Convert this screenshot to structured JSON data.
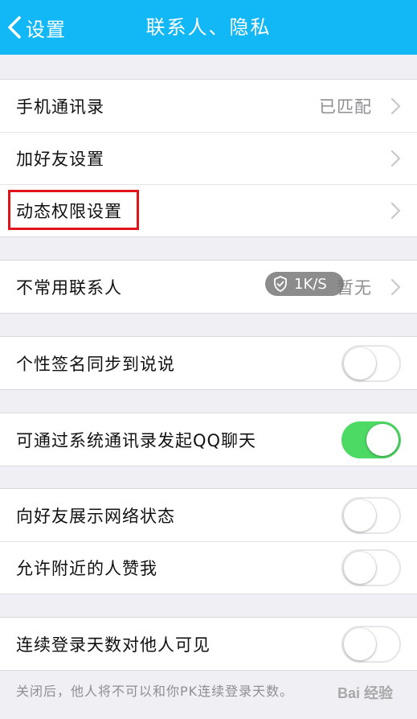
{
  "nav": {
    "back_label": "设置",
    "title": "联系人、隐私"
  },
  "groups": [
    {
      "rows": [
        {
          "label": "手机通讯录",
          "value": "已匹配"
        },
        {
          "label": "加好友设置"
        },
        {
          "label": "动态权限设置"
        }
      ]
    },
    {
      "rows": [
        {
          "label": "不常用联系人",
          "value": "暂无"
        }
      ]
    },
    {
      "rows": [
        {
          "label": "个性签名同步到说说",
          "toggle": false
        }
      ]
    },
    {
      "rows": [
        {
          "label": "可通过系统通讯录发起QQ聊天",
          "toggle": true
        }
      ]
    },
    {
      "rows": [
        {
          "label": "向好友展示网络状态",
          "toggle": false
        },
        {
          "label": "允许附近的人赞我",
          "toggle": false
        }
      ]
    },
    {
      "rows": [
        {
          "label": "连续登录天数对他人可见",
          "toggle": false
        }
      ]
    }
  ],
  "footer_note": "关闭后，他人将不可以和你PK连续登录天数。",
  "overlay": {
    "speed_text": "1K/S",
    "icon": "shield-check-icon"
  },
  "watermark": "Bai 经验",
  "colors": {
    "nav_bar": "#12b7f5",
    "toggle_on": "#4cd964",
    "highlight": "#e1141c"
  }
}
